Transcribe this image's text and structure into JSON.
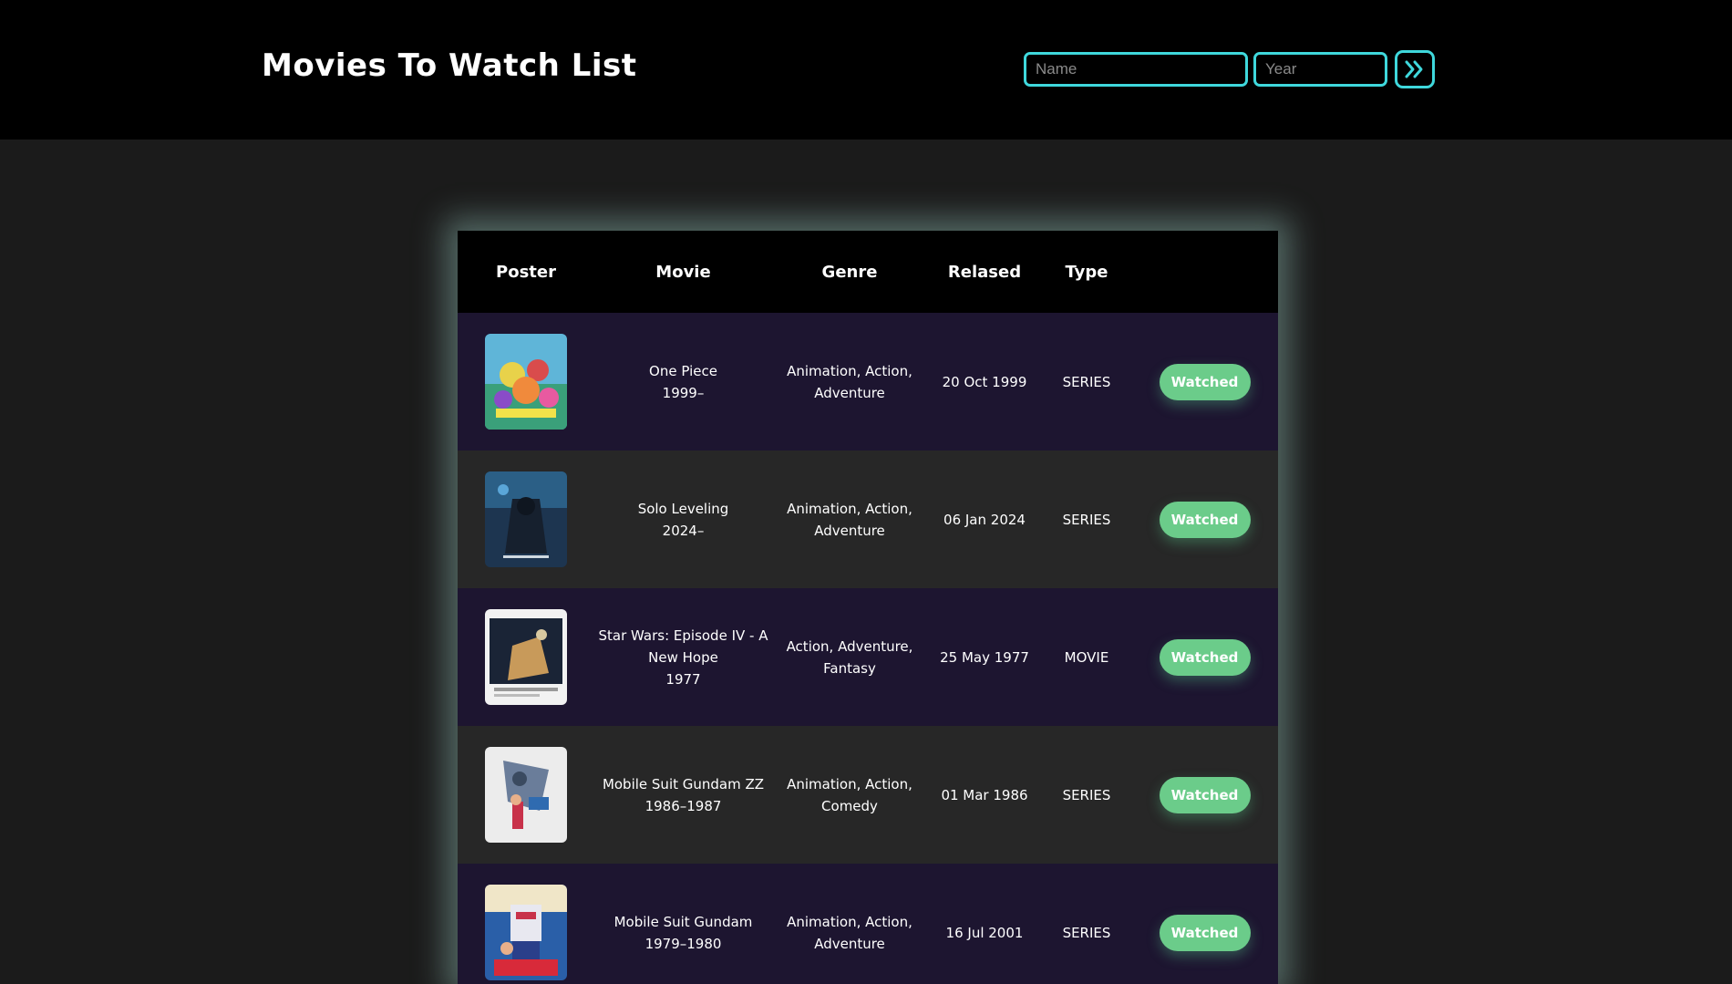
{
  "header": {
    "title": "Movies To Watch List",
    "name_placeholder": "Name",
    "year_placeholder": "Year",
    "submit_icon": "double-chevron-right-icon"
  },
  "colors": {
    "accent": "#3fd8dc",
    "watched": "#6bcc8a",
    "row_odd": "#1d1530",
    "row_even": "#272727"
  },
  "table": {
    "columns": [
      "Poster",
      "Movie",
      "Genre",
      "Relased",
      "Type",
      ""
    ],
    "rows": [
      {
        "title": "One Piece",
        "years": "1999–",
        "genre_line1": "Animation, Action,",
        "genre_line2": "Adventure",
        "released": "20 Oct 1999",
        "type": "SERIES",
        "status": "Watched",
        "poster": "one-piece-poster"
      },
      {
        "title": "Solo Leveling",
        "years": "2024–",
        "genre_line1": "Animation, Action,",
        "genre_line2": "Adventure",
        "released": "06 Jan 2024",
        "type": "SERIES",
        "status": "Watched",
        "poster": "solo-leveling-poster"
      },
      {
        "title": "Star Wars: Episode IV - A",
        "title_line2": "New Hope",
        "years": "1977",
        "genre_line1": "Action, Adventure,",
        "genre_line2": "Fantasy",
        "released": "25 May 1977",
        "type": "MOVIE",
        "status": "Watched",
        "poster": "star-wars-poster"
      },
      {
        "title": "Mobile Suit Gundam ZZ",
        "years": "1986–1987",
        "genre_line1": "Animation, Action,",
        "genre_line2": "Comedy",
        "released": "01 Mar 1986",
        "type": "SERIES",
        "status": "Watched",
        "poster": "gundam-zz-poster"
      },
      {
        "title": "Mobile Suit Gundam",
        "years": "1979–1980",
        "genre_line1": "Animation, Action,",
        "genre_line2": "Adventure",
        "released": "16 Jul 2001",
        "type": "SERIES",
        "status": "Watched",
        "poster": "gundam-poster"
      }
    ]
  }
}
